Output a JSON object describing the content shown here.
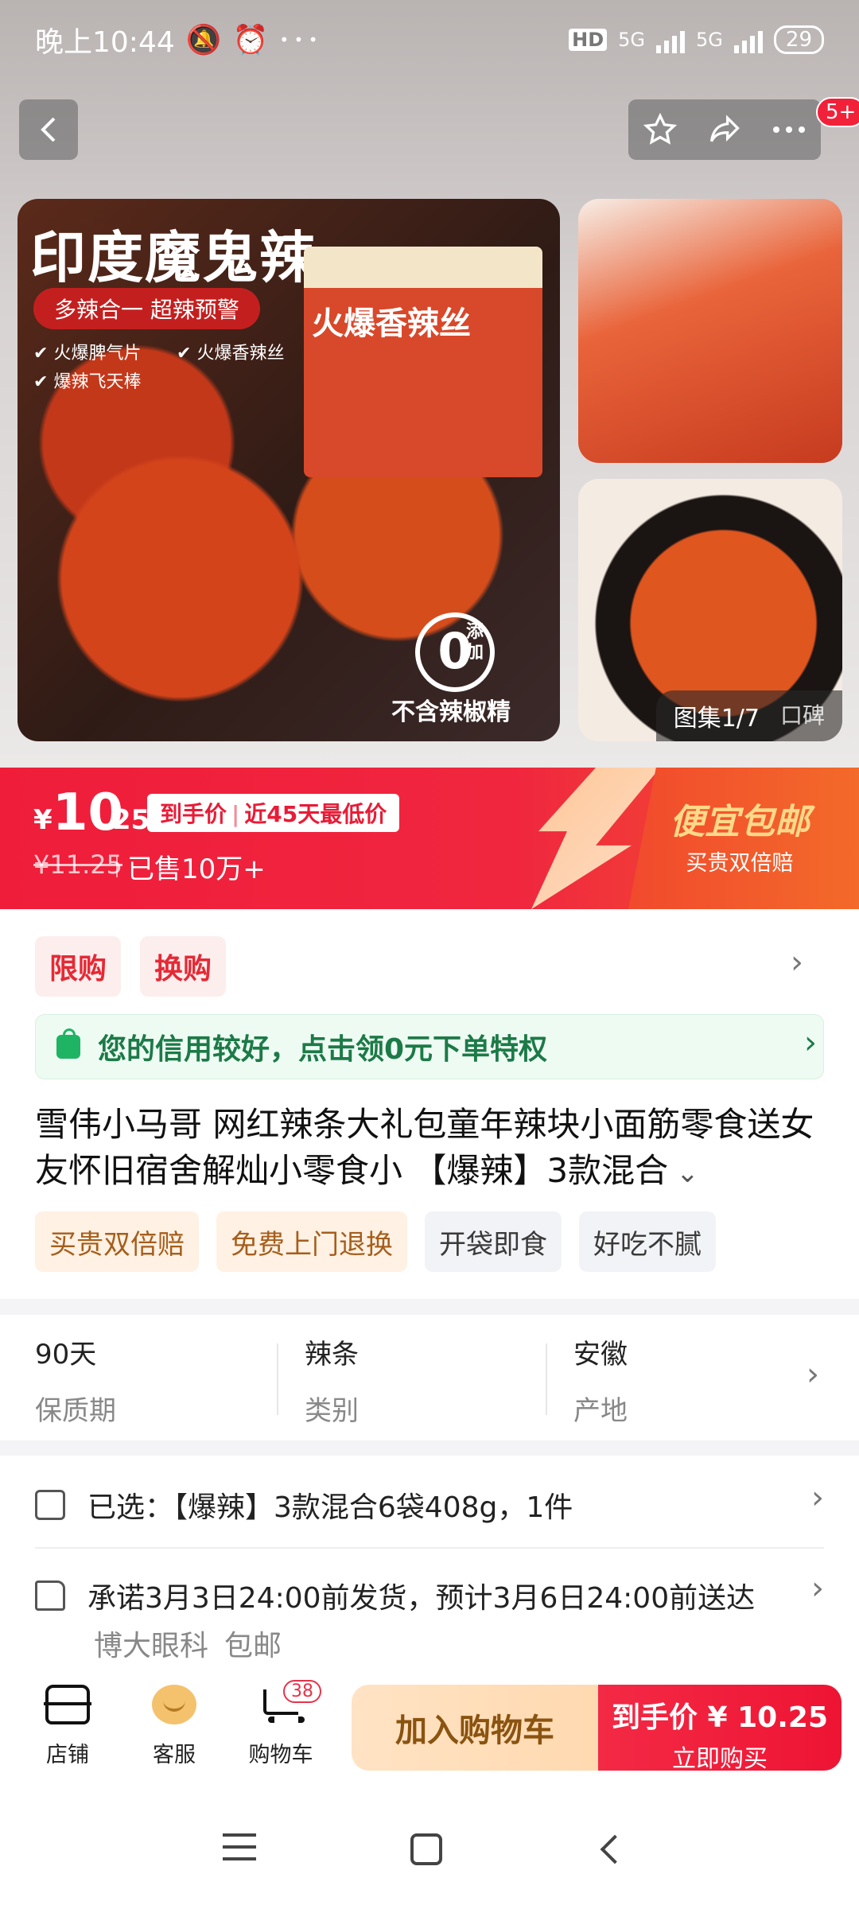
{
  "status_bar": {
    "time": "晚上10:44",
    "network_1": "5G",
    "network_2": "5G",
    "battery": "29",
    "hd": "HD"
  },
  "header": {
    "notification_badge": "5+"
  },
  "hero": {
    "main_image": {
      "title": "印度魔鬼辣",
      "pill": "多辣合一 超辣预警",
      "checks": [
        "火爆脾气片",
        "火爆香辣丝",
        "爆辣飞天棒"
      ],
      "package_text": "火爆香辣丝",
      "zero_label": "0",
      "zero_sub": "添加",
      "no_chili": "不含辣椒精"
    },
    "gallery": {
      "count": "图集1/7",
      "reviews": "口碑"
    }
  },
  "price": {
    "currency": "¥",
    "integer": "10",
    "decimal": ".25",
    "tag_a": "到手价",
    "tag_b": "近45天最低价",
    "original": "¥11.25",
    "sold": "已售10万+",
    "shipping": "便宜包邮",
    "guarantee": "买贵双倍赔"
  },
  "promo": {
    "chips": [
      "限购",
      "换购"
    ],
    "credit_text": "您的信用较好，点击领0元下单特权"
  },
  "product": {
    "title": "雪伟小马哥 网红辣条大礼包童年辣块小面筋零食送女友怀旧宿舍解灿小零食小 【爆辣】3款混合",
    "tags_orange": [
      "买贵双倍赔",
      "免费上门退换"
    ],
    "tags_gray": [
      "开袋即食",
      "好吃不腻"
    ]
  },
  "specs": [
    {
      "value": "90天",
      "key": "保质期"
    },
    {
      "value": "辣条",
      "key": "类别"
    },
    {
      "value": "安徽",
      "key": "产地"
    }
  ],
  "selection": {
    "selected": "已选：【爆辣】3款混合6袋408g，1件",
    "shipping": "承诺3月3日24:00前发货，预计3月6日24:00前送达",
    "sub_a": "博大眼科",
    "sub_b": "包邮"
  },
  "bottom_bar": {
    "store": "店铺",
    "service": "客服",
    "cart": "购物车",
    "cart_count": "38",
    "add_to_cart": "加入购物车",
    "buy_price": "到手价 ¥ 10.25",
    "buy_now": "立即购买"
  },
  "colors": {
    "accent_red": "#ef1d3a",
    "credit_green": "#1fb463",
    "ship_gold": "#ffd98a"
  }
}
